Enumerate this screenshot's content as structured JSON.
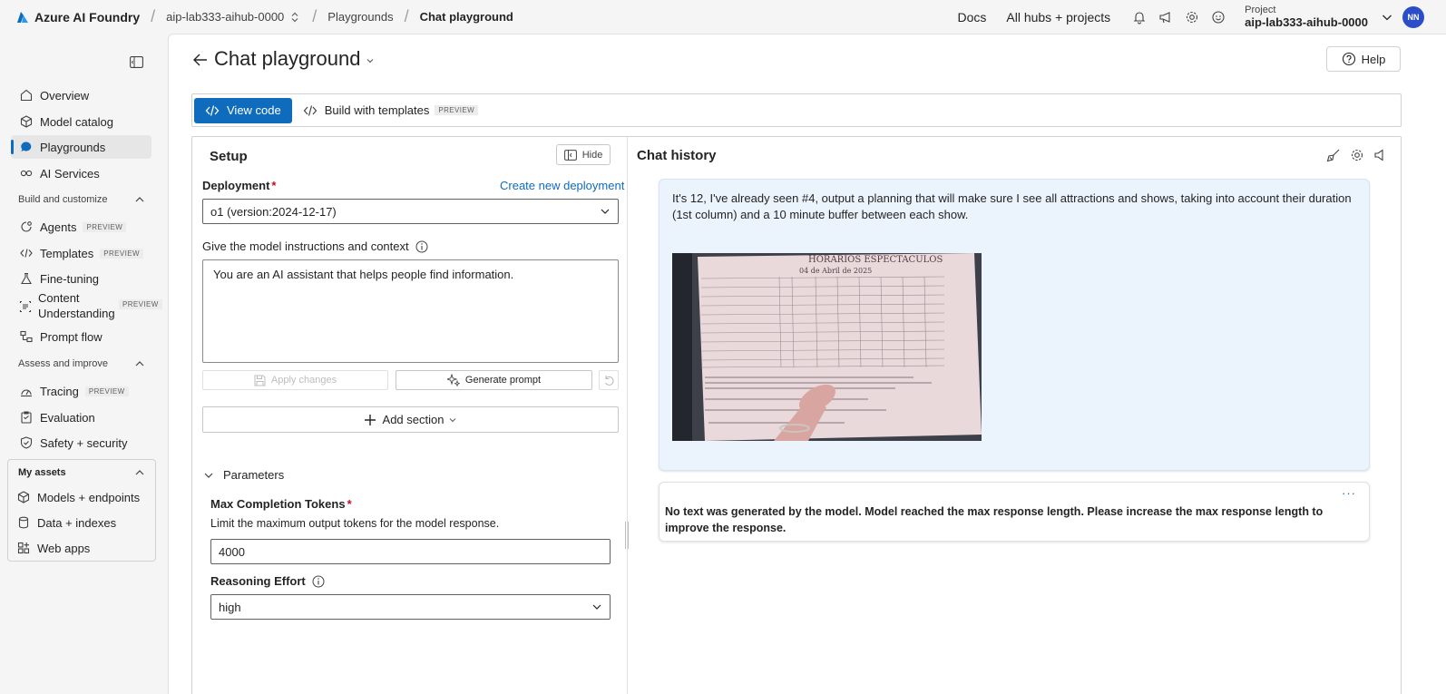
{
  "topbar": {
    "app_name": "Azure AI Foundry",
    "hub": "aip-lab333-aihub-0000",
    "breadcrumb": [
      "Playgrounds",
      "Chat playground"
    ],
    "docs": "Docs",
    "all_hubs": "All hubs + projects",
    "project_label": "Project",
    "project_name": "aip-lab333-aihub-0000",
    "avatar_initials": "NN"
  },
  "sidebar": {
    "items": [
      {
        "label": "Overview",
        "icon": "overview-icon"
      },
      {
        "label": "Model catalog",
        "icon": "cube-icon"
      },
      {
        "label": "Playgrounds",
        "icon": "chat-icon",
        "active": true
      },
      {
        "label": "AI Services",
        "icon": "ai-services-icon"
      }
    ],
    "build_group": "Build and customize",
    "build_items": [
      {
        "label": "Agents",
        "preview": "PREVIEW"
      },
      {
        "label": "Templates",
        "preview": "PREVIEW"
      },
      {
        "label": "Fine-tuning"
      },
      {
        "label": "Content Understanding",
        "preview": "PREVIEW"
      },
      {
        "label": "Prompt flow"
      }
    ],
    "assess_group": "Assess and improve",
    "assess_items": [
      {
        "label": "Tracing",
        "preview": "PREVIEW"
      },
      {
        "label": "Evaluation"
      },
      {
        "label": "Safety + security"
      }
    ],
    "assets_group": "My assets",
    "assets_items": [
      {
        "label": "Models + endpoints"
      },
      {
        "label": "Data + indexes"
      },
      {
        "label": "Web apps"
      }
    ]
  },
  "main": {
    "title": "Chat playground",
    "help": "Help",
    "toolbar": {
      "view_code": "View code",
      "build_templates": "Build with templates",
      "preview": "PREVIEW"
    }
  },
  "setup": {
    "title": "Setup",
    "hide": "Hide",
    "deployment_label": "Deployment",
    "required_mark": "*",
    "create_link": "Create new deployment",
    "deployment_value": "o1 (version:2024-12-17)",
    "instructions_label": "Give the model instructions and context",
    "instructions_value": "You are an AI assistant that helps people find information.",
    "apply_changes": "Apply changes",
    "generate_prompt": "Generate prompt",
    "add_section": "Add section",
    "parameters": "Parameters",
    "max_tokens_label": "Max Completion Tokens",
    "max_tokens_desc": "Limit the maximum output tokens for the model response.",
    "max_tokens_value": "4000",
    "reasoning_label": "Reasoning Effort",
    "reasoning_value": "high"
  },
  "chat": {
    "title": "Chat history",
    "user_message": "It's 12, I've already seen #4, output a planning that will make sure I see all attractions and shows, taking into account their duration (1st column) and a 10 minute buffer between each show.",
    "image_heading": "HORARIOS ESPECTACULOS",
    "image_date": "04 de Abril de 2025",
    "bot_more": "···",
    "bot_message": "No text was generated by the model. Model reached the max response length. Please increase the max response length to improve the response."
  }
}
